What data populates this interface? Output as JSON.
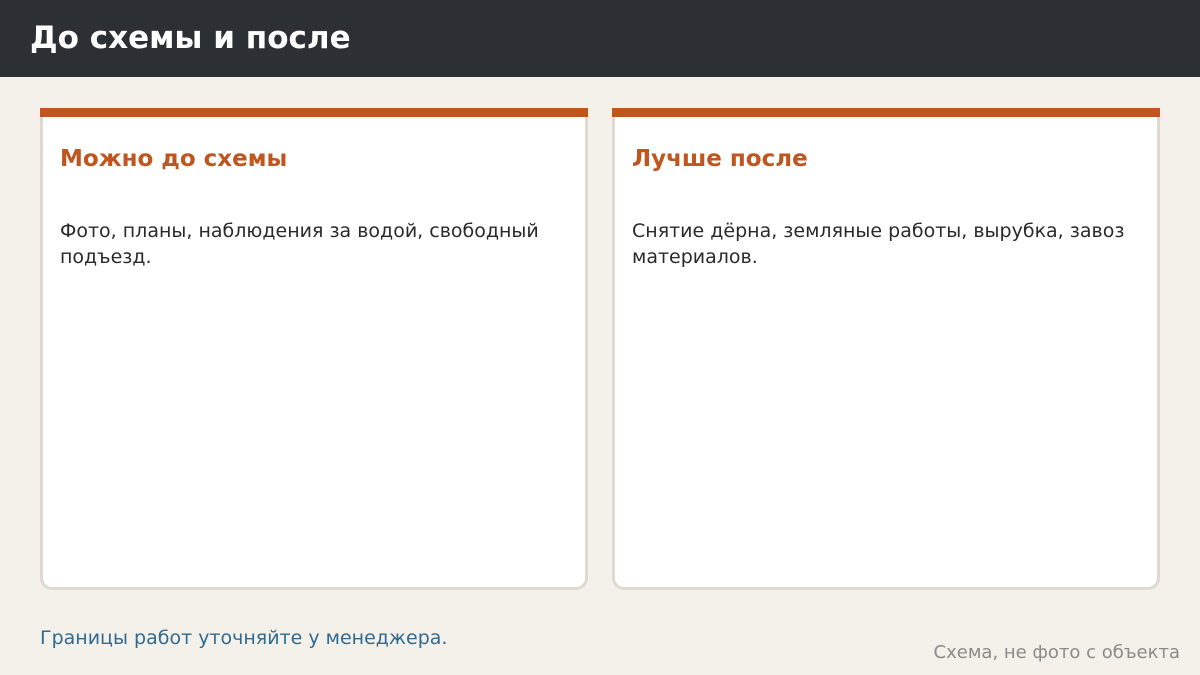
{
  "header": {
    "title": "До схемы и после"
  },
  "cards": [
    {
      "title": "Можно до схемы",
      "body": "Фото, планы, наблюдения за водой, свободный подъезд."
    },
    {
      "title": "Лучше после",
      "body": "Снятие дёрна, земляные работы, вырубка, завоз материалов."
    }
  ],
  "footer": {
    "note": "Границы работ уточняйте у менеджера.",
    "caption": "Схема, не фото с объекта"
  },
  "colors": {
    "header_bg": "#2c2f34",
    "page_bg": "#f4f1eb",
    "accent": "#c0561f",
    "note_link": "#2e6a93",
    "caption": "#8a8a8a"
  }
}
